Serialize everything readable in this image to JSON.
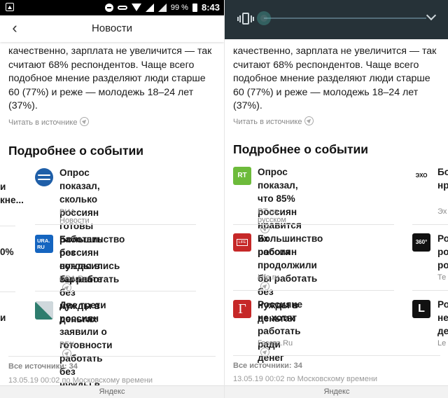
{
  "left": {
    "status_bar": {
      "battery": "99 %",
      "time": "8:43"
    },
    "header": {
      "title": "Новости"
    },
    "article": {
      "lines": [
        "качественно, зарплата не увеличится — так",
        "считают 68% респондентов. Чаще всего",
        "подобное мнение разделяют люди старше",
        "60 (77%) и реже — молодежь 18–24 лет",
        "(37%)."
      ],
      "source_link": "Читать в источнике"
    },
    "section_title": "Подробнее о событии",
    "cards": [
      {
        "lines": [
          "Опрос показал, сколько",
          "россиян готовы работать без",
          "нужды в зарплате"
        ],
        "source": "РИА Новости",
        "logo": "ria-logo-icon"
      },
      {
        "lines": [
          "Большинство россиян",
          "согласились бы работать без",
          "нужды в деньгах"
        ],
        "source": "URA.Ru",
        "logo": "ura-logo-icon",
        "logo_text": "URA.\nRU"
      },
      {
        "lines": [
          "Две трети россиян заявили о",
          "готовности работать без",
          "нужды в заработке"
        ],
        "source": "РБК",
        "logo": "rbc-logo-icon"
      }
    ],
    "partials": [
      "и",
      "кне...",
      "0%",
      "и"
    ],
    "footer": {
      "all_sources": "Все источники: 34",
      "date": "13.05.19 00:02 по Московскому времени"
    },
    "bottom": "Яндекс"
  },
  "right": {
    "article": {
      "lines": [
        "качественно, зарплата не увеличится — так",
        "считают 68% респондентов. Чаще всего",
        "подобное мнение разделяют люди старше",
        "60 (77%) и реже — молодежь 18–24 лет",
        "(37%)."
      ],
      "source_link": "Читать в источнике"
    },
    "section_title": "Подробнее о событии",
    "cards": [
      {
        "lines": [
          "Опрос показал, что 85%",
          "россиян нравится их работа"
        ],
        "source": "RT на русском",
        "logo": "rt-logo-icon",
        "logo_text": "RT"
      },
      {
        "lines": [
          "Большинство россиян",
          "продолжили бы работать без",
          "нужды в деньгах"
        ],
        "source": "Life.ru",
        "logo": "life-logo-icon",
        "logo_text": "LIFE"
      },
      {
        "lines": [
          "Россияне не хотят работать",
          "ради денег"
        ],
        "source": "Газета.Ru",
        "logo": "gazeta-logo-icon",
        "logo_text": "Г"
      }
    ],
    "side_column": {
      "items": [
        {
          "lines": [
            "Бо",
            "нр",
            "Эх"
          ],
          "logo_text": "ЭХО"
        },
        {
          "lines": [
            "Ро",
            "ро",
            "ро",
            "Те"
          ],
          "logo_text": "360°"
        },
        {
          "lines": [
            "Ро",
            "не",
            "де",
            "Le"
          ],
          "logo_text": "L"
        }
      ]
    },
    "footer": {
      "all_sources": "Все источники: 34",
      "date": "13.05.19 00:02 по Московскому времени"
    },
    "bottom": "Яндекс"
  }
}
